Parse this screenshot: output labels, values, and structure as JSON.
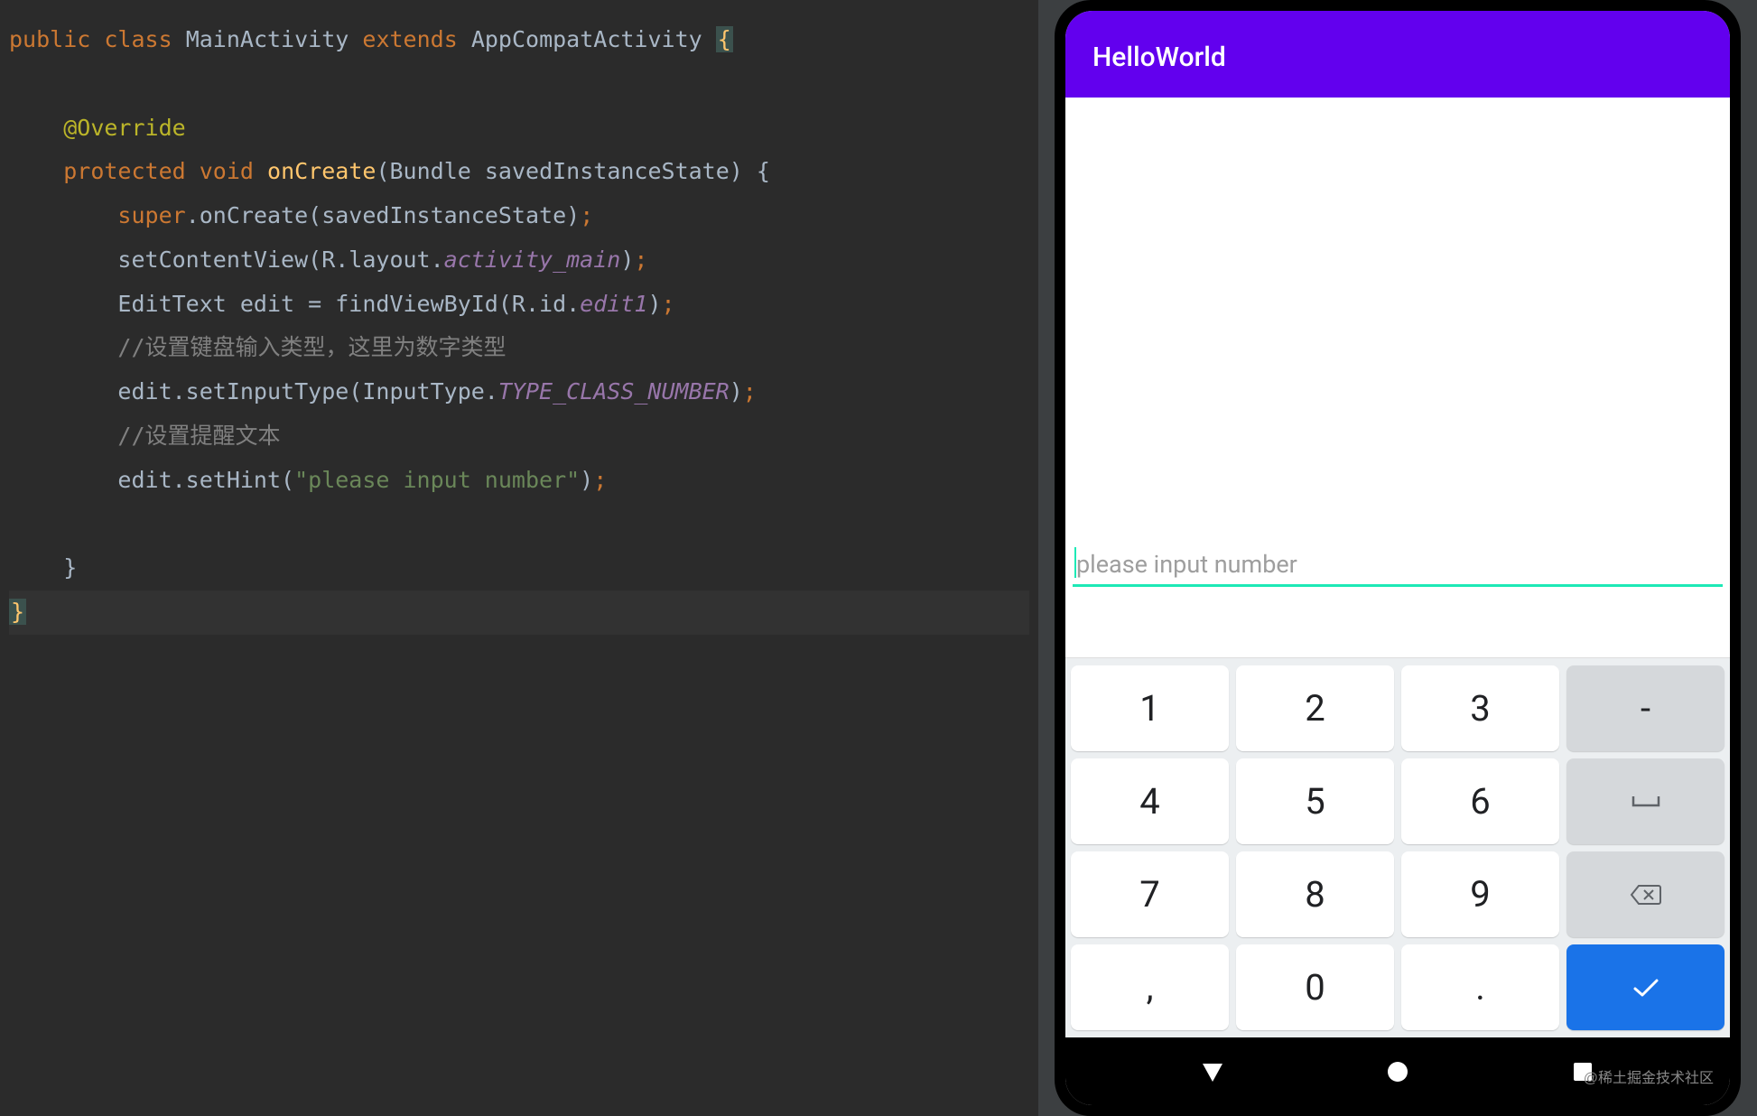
{
  "code": {
    "line1_public": "public",
    "line1_class": "class",
    "line1_name": "MainActivity",
    "line1_extends": "extends",
    "line1_parent": "AppCompatActivity",
    "line1_brace": "{",
    "line3_annotation": "@Override",
    "line4_protected": "protected",
    "line4_void": "void",
    "line4_method": "onCreate",
    "line4_params": "(Bundle savedInstanceState) {",
    "line5_super": "super",
    "line5_rest": ".onCreate(savedInstanceState)",
    "line5_semi": ";",
    "line6_a": "setContentView(R.layout.",
    "line6_field": "activity_main",
    "line6_b": ")",
    "line6_semi": ";",
    "line7_a": "EditText edit = findViewById(R.id.",
    "line7_field": "edit1",
    "line7_b": ")",
    "line7_semi": ";",
    "line8_comment": "//设置键盘输入类型，这里为数字类型",
    "line9_a": "edit.setInputType(InputType.",
    "line9_field": "TYPE_CLASS_NUMBER",
    "line9_b": ")",
    "line9_semi": ";",
    "line10_comment": "//设置提醒文本",
    "line11_a": "edit.setHint(",
    "line11_str": "\"please input number\"",
    "line11_b": ")",
    "line11_semi": ";",
    "line13_brace": "}",
    "line14_brace": "}"
  },
  "app": {
    "title": "HelloWorld",
    "edit_placeholder": "please input number"
  },
  "keyboard": {
    "rows": [
      [
        "1",
        "2",
        "3",
        "-"
      ],
      [
        "4",
        "5",
        "6",
        "␣"
      ],
      [
        "7",
        "8",
        "9",
        "⌫"
      ],
      [
        ",",
        "0",
        ".",
        "✓"
      ]
    ],
    "k1": "1",
    "k2": "2",
    "k3": "3",
    "kdash": "-",
    "k4": "4",
    "k5": "5",
    "k6": "6",
    "k7": "7",
    "k8": "8",
    "k9": "9",
    "kcomma": ",",
    "k0": "0",
    "kdot": "."
  },
  "watermark": "@稀土掘金技术社区"
}
